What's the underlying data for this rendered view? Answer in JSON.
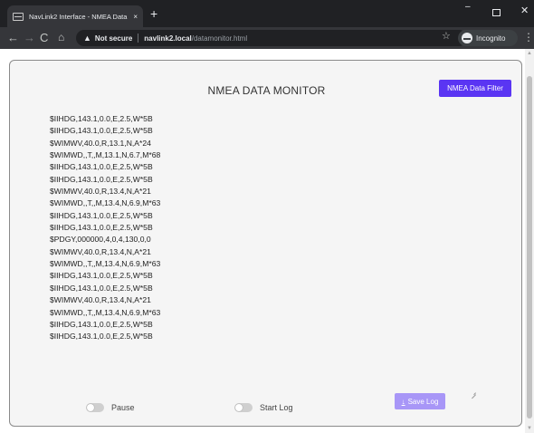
{
  "browser": {
    "tab_title": "NavLink2 Interface - NMEA Data",
    "tab_close": "×",
    "new_tab": "+",
    "window_controls": {
      "minimize": "–",
      "close": "✕"
    },
    "nav": {
      "back": "←",
      "forward": "→",
      "reload": "C",
      "home": "⌂"
    },
    "security_label": "Not secure",
    "url_host": "navlink2.local",
    "url_path": "/datamonitor.html",
    "profile_label": "Incognito",
    "star": "☆",
    "menu": "⋮"
  },
  "page": {
    "title": "NMEA DATA MONITOR",
    "filter_button": "NMEA Data Filter",
    "log_lines": [
      "$IIHDG,143.1,0.0,E,2.5,W*5B",
      "$IIHDG,143.1,0.0,E,2.5,W*5B",
      "$WIMWV,40.0,R,13.1,N,A*24",
      "$WIMWD,,T,,M,13.1,N,6.7,M*68",
      "$IIHDG,143.1,0.0,E,2.5,W*5B",
      "$IIHDG,143.1,0.0,E,2.5,W*5B",
      "$WIMWV,40.0,R,13.4,N,A*21",
      "$WIMWD,,T,,M,13.4,N,6.9,M*63",
      "$IIHDG,143.1,0.0,E,2.5,W*5B",
      "$IIHDG,143.1,0.0,E,2.5,W*5B",
      "$PDGY,000000,4,0,4,130,0,0",
      "$WIMWV,40.0,R,13.4,N,A*21",
      "$WIMWD,,T,,M,13.4,N,6.9,M*63",
      "$IIHDG,143.1,0.0,E,2.5,W*5B",
      "$IIHDG,143.1,0.0,E,2.5,W*5B",
      "$WIMWV,40.0,R,13.4,N,A*21",
      "$WIMWD,,T,,M,13.4,N,6.9,M*63",
      "$IIHDG,143.1,0.0,E,2.5,W*5B",
      "$IIHDG,143.1,0.0,E,2.5,W*5B"
    ],
    "pause_label": "Pause",
    "pause_on": false,
    "start_log_label": "Start Log",
    "start_log_on": false,
    "save_log_label": "Save Log",
    "save_log_icon": "download-icon"
  },
  "colors": {
    "accent": "#5a35f3",
    "accent_disabled": "#a896f7",
    "card_background": "#f5f5f5"
  }
}
